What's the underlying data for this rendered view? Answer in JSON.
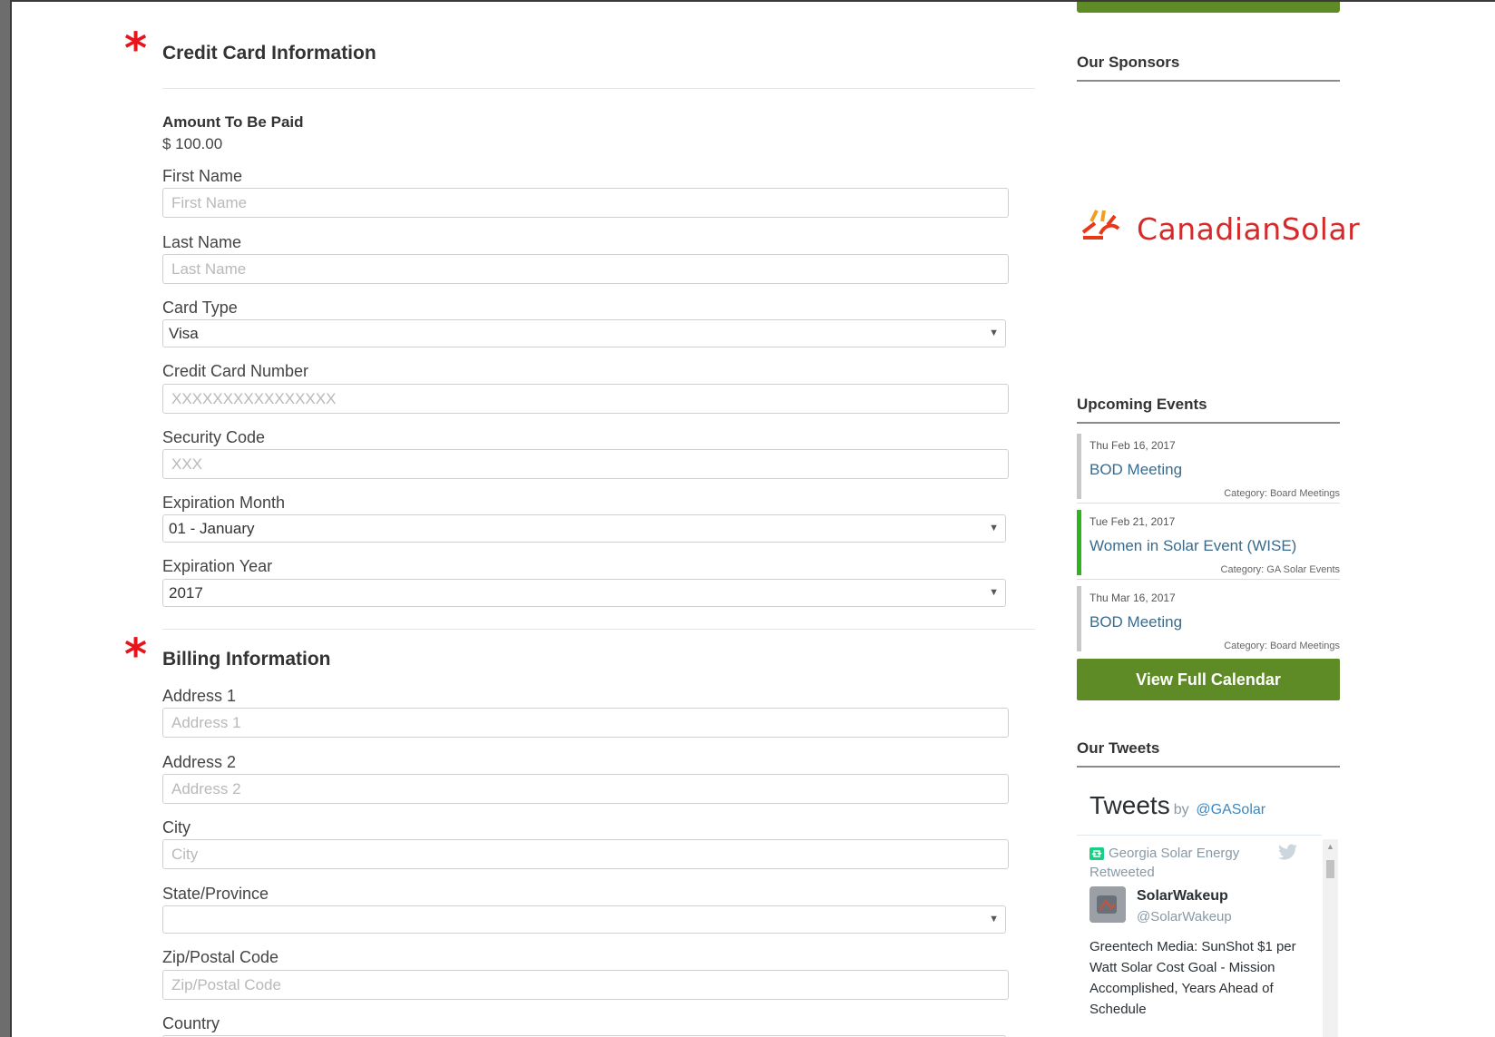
{
  "credit_card": {
    "section_title": "Credit Card Information",
    "amount_label": "Amount To Be Paid",
    "amount_value": "$ 100.00",
    "first_name": {
      "label": "First Name",
      "placeholder": "First Name",
      "value": ""
    },
    "last_name": {
      "label": "Last Name",
      "placeholder": "Last Name",
      "value": ""
    },
    "card_type": {
      "label": "Card Type",
      "selected": "Visa"
    },
    "card_number": {
      "label": "Credit Card Number",
      "placeholder": "XXXXXXXXXXXXXXXX",
      "value": ""
    },
    "security_code": {
      "label": "Security Code",
      "placeholder": "XXX",
      "value": ""
    },
    "exp_month": {
      "label": "Expiration Month",
      "selected": "01 - January"
    },
    "exp_year": {
      "label": "Expiration Year",
      "selected": "2017"
    }
  },
  "billing": {
    "section_title": "Billing Information",
    "address1": {
      "label": "Address 1",
      "placeholder": "Address 1",
      "value": ""
    },
    "address2": {
      "label": "Address 2",
      "placeholder": "Address 2",
      "value": ""
    },
    "city": {
      "label": "City",
      "placeholder": "City",
      "value": ""
    },
    "state": {
      "label": "State/Province",
      "selected": ""
    },
    "zip": {
      "label": "Zip/Postal Code",
      "placeholder": "Zip/Postal Code",
      "value": ""
    },
    "country": {
      "label": "Country"
    }
  },
  "required_marker": "*",
  "caret": "▼",
  "sidebar": {
    "sponsors_heading": "Our Sponsors",
    "sponsor_logo_text": "CanadianSolar",
    "events_heading": "Upcoming Events",
    "events": [
      {
        "date": "Thu Feb 16, 2017",
        "title": "BOD Meeting",
        "category": "Category: Board Meetings",
        "accent": "#c8c8c8"
      },
      {
        "date": "Tue Feb 21, 2017",
        "title": "Women in Solar Event (WISE)",
        "category": "Category: GA Solar Events",
        "accent": "#2db51c"
      },
      {
        "date": "Thu Mar 16, 2017",
        "title": "BOD Meeting",
        "category": "Category: Board Meetings",
        "accent": "#c8c8c8"
      }
    ],
    "calendar_button": "View Full Calendar",
    "tweets_heading": "Our Tweets",
    "tweets_widget": {
      "title": "Tweets",
      "by": "by",
      "handle": "@GASolar",
      "retweeted_by": "Georgia Solar Energy",
      "retweeted_label": "Retweeted",
      "author_name": "SolarWakeup",
      "author_handle": "@SolarWakeup",
      "tweet_text": "Greentech Media: SunShot $1 per Watt Solar Cost Goal - Mission Accomplished, Years Ahead of Schedule"
    }
  },
  "colors": {
    "accent_green": "#5f8b27",
    "required_red": "#e8141b",
    "link_blue": "#3a6a8c"
  }
}
